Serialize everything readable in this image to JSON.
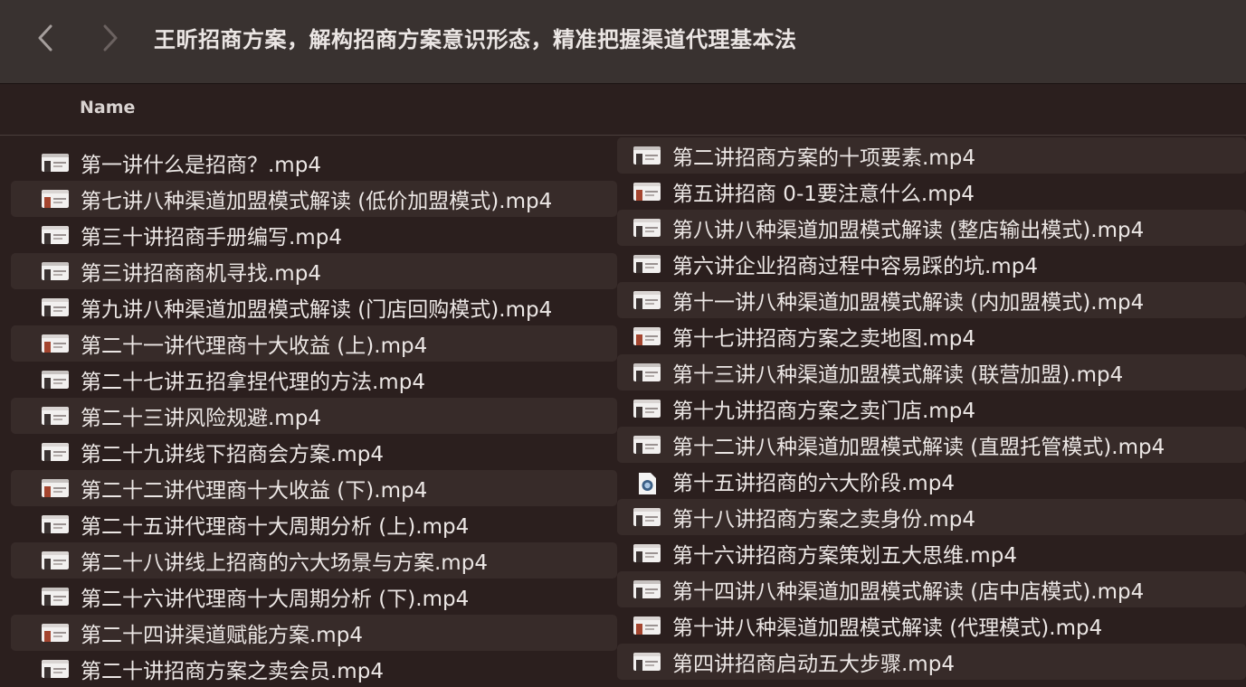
{
  "window": {
    "title": "王昕招商方案，解构招商方案意识形态，精准把握渠道代理基本法"
  },
  "nav": {
    "back_icon": "chevron-left-icon",
    "forward_icon": "chevron-right-icon"
  },
  "header": {
    "name_label": "Name"
  },
  "files_left": [
    {
      "name": "第一讲什么是招商？.mp4",
      "icon": "video-thumbnail-icon"
    },
    {
      "name": "第七讲八种渠道加盟模式解读 (低价加盟模式).mp4",
      "icon": "video-thumbnail-icon"
    },
    {
      "name": "第三十讲招商手册编写.mp4",
      "icon": "video-thumbnail-icon"
    },
    {
      "name": "第三讲招商商机寻找.mp4",
      "icon": "video-thumbnail-icon"
    },
    {
      "name": "第九讲八种渠道加盟模式解读 (门店回购模式).mp4",
      "icon": "video-thumbnail-icon"
    },
    {
      "name": "第二十一讲代理商十大收益 (上).mp4",
      "icon": "video-thumbnail-icon"
    },
    {
      "name": "第二十七讲五招拿捏代理的方法.mp4",
      "icon": "video-thumbnail-icon"
    },
    {
      "name": "第二十三讲风险规避.mp4",
      "icon": "video-thumbnail-icon"
    },
    {
      "name": "第二十九讲线下招商会方案.mp4",
      "icon": "video-thumbnail-icon"
    },
    {
      "name": "第二十二讲代理商十大收益 (下).mp4",
      "icon": "video-thumbnail-icon"
    },
    {
      "name": "第二十五讲代理商十大周期分析 (上).mp4",
      "icon": "video-thumbnail-icon"
    },
    {
      "name": "第二十八讲线上招商的六大场景与方案.mp4",
      "icon": "video-thumbnail-icon"
    },
    {
      "name": "第二十六讲代理商十大周期分析 (下).mp4",
      "icon": "video-thumbnail-icon"
    },
    {
      "name": "第二十四讲渠道赋能方案.mp4",
      "icon": "video-thumbnail-icon"
    },
    {
      "name": "第二十讲招商方案之卖会员.mp4",
      "icon": "video-thumbnail-icon"
    }
  ],
  "files_right": [
    {
      "name": "第二讲招商方案的十项要素.mp4",
      "icon": "video-thumbnail-icon"
    },
    {
      "name": "第五讲招商 0-1要注意什么.mp4",
      "icon": "video-thumbnail-icon"
    },
    {
      "name": "第八讲八种渠道加盟模式解读 (整店输出模式).mp4",
      "icon": "video-thumbnail-icon"
    },
    {
      "name": "第六讲企业招商过程中容易踩的坑.mp4",
      "icon": "video-thumbnail-icon"
    },
    {
      "name": "第十一讲八种渠道加盟模式解读 (内加盟模式).mp4",
      "icon": "video-thumbnail-icon"
    },
    {
      "name": "第十七讲招商方案之卖地图.mp4",
      "icon": "video-thumbnail-icon"
    },
    {
      "name": "第十三讲八种渠道加盟模式解读 (联营加盟).mp4",
      "icon": "video-thumbnail-icon"
    },
    {
      "name": "第十九讲招商方案之卖门店.mp4",
      "icon": "video-thumbnail-icon"
    },
    {
      "name": "第十二讲八种渠道加盟模式解读 (直盟托管模式).mp4",
      "icon": "video-thumbnail-icon"
    },
    {
      "name": "第十五讲招商的六大阶段.mp4",
      "icon": "quicktime-file-icon"
    },
    {
      "name": "第十八讲招商方案之卖身份.mp4",
      "icon": "video-thumbnail-icon"
    },
    {
      "name": "第十六讲招商方案策划五大思维.mp4",
      "icon": "video-thumbnail-icon"
    },
    {
      "name": "第十四讲八种渠道加盟模式解读 (店中店模式).mp4",
      "icon": "video-thumbnail-icon"
    },
    {
      "name": "第十讲八种渠道加盟模式解读 (代理模式).mp4",
      "icon": "video-thumbnail-icon"
    },
    {
      "name": "第四讲招商启动五大步骤.mp4",
      "icon": "video-thumbnail-icon"
    }
  ]
}
